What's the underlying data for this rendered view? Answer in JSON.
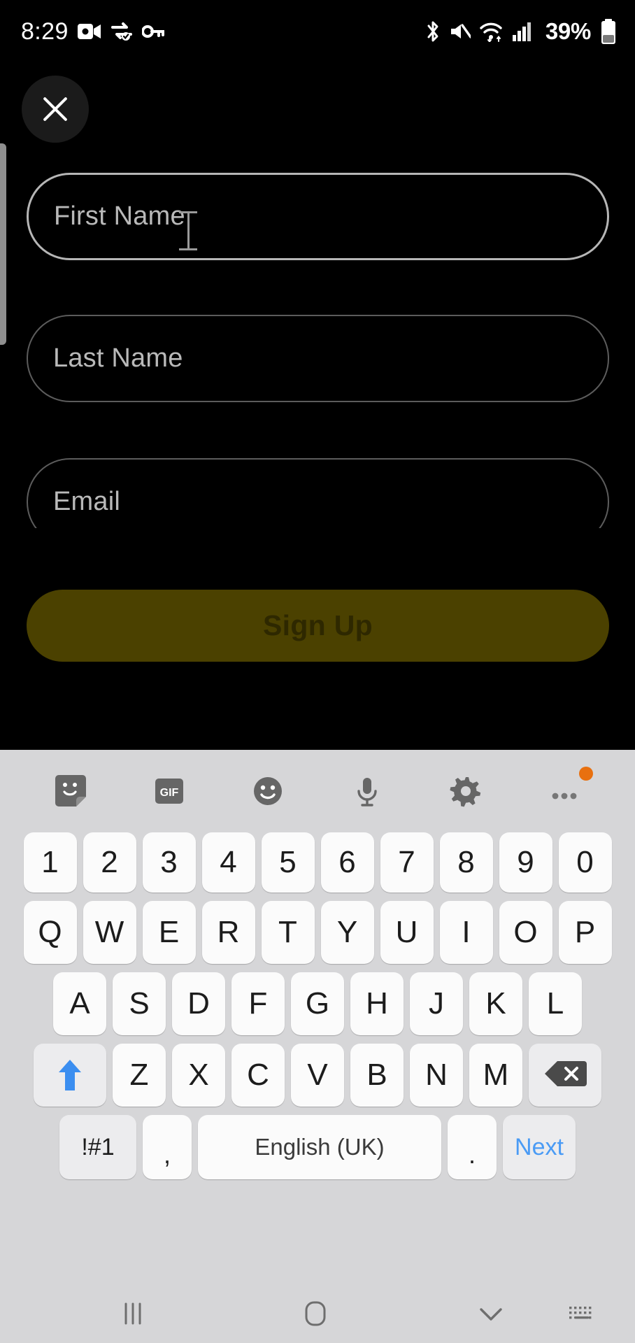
{
  "status_bar": {
    "time": "8:29",
    "battery_percent": "39%",
    "left_icons": [
      "screen-record-icon",
      "data-sync-icon",
      "vpn-key-icon"
    ],
    "right_icons": [
      "bluetooth-icon",
      "mute-icon",
      "wifi-icon",
      "signal-icon",
      "battery-icon"
    ]
  },
  "header": {
    "close_icon": "close-icon"
  },
  "form": {
    "fields": [
      {
        "name": "first-name",
        "placeholder": "First Name",
        "value": "",
        "focused": true
      },
      {
        "name": "last-name",
        "placeholder": "Last Name",
        "value": "",
        "focused": false
      },
      {
        "name": "email",
        "placeholder": "Email",
        "value": "",
        "focused": false
      }
    ],
    "submit_label": "Sign Up",
    "submit_color": "#4b4100",
    "submit_text_color": "#2e2800"
  },
  "keyboard": {
    "toolbar": [
      {
        "name": "sticker-icon",
        "label": ""
      },
      {
        "name": "gif-icon",
        "label": "GIF"
      },
      {
        "name": "emoji-icon",
        "label": ""
      },
      {
        "name": "microphone-icon",
        "label": ""
      },
      {
        "name": "gear-icon",
        "label": ""
      },
      {
        "name": "more-options-icon",
        "label": ""
      }
    ],
    "badge_color": "#e8700f",
    "rows": {
      "numbers": [
        "1",
        "2",
        "3",
        "4",
        "5",
        "6",
        "7",
        "8",
        "9",
        "0"
      ],
      "top": [
        "Q",
        "W",
        "E",
        "R",
        "T",
        "Y",
        "U",
        "I",
        "O",
        "P"
      ],
      "home": [
        "A",
        "S",
        "D",
        "F",
        "G",
        "H",
        "J",
        "K",
        "L"
      ],
      "bottom": [
        "Z",
        "X",
        "C",
        "V",
        "B",
        "N",
        "M"
      ]
    },
    "shift_label": "shift-icon",
    "shift_active": true,
    "shift_color": "#3b8ef0",
    "backspace_label": "backspace-icon",
    "symbols_key": "!#1",
    "comma_key": ",",
    "space_key": "English (UK)",
    "period_key": ".",
    "action_key": "Next",
    "action_key_color": "#4a9bf5"
  },
  "nav_bar": {
    "recents": "recents-icon",
    "home": "home-icon",
    "hide_keyboard": "chevron-down-icon",
    "keyboard_switch": "keyboard-switch-icon"
  }
}
